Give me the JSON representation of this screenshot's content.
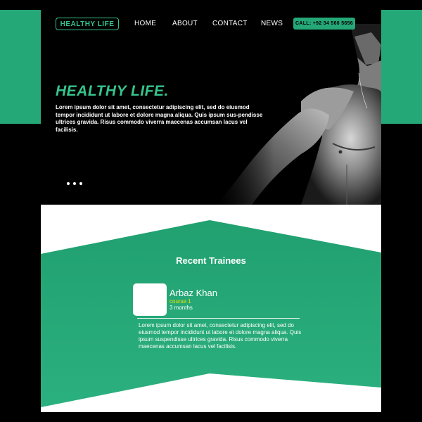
{
  "brand": {
    "logo_text": "HEALTHY LIFE",
    "accent_color": "#36c48d",
    "band_color": "#25a878"
  },
  "nav": {
    "items": [
      {
        "label": "HOME"
      },
      {
        "label": "ABOUT"
      },
      {
        "label": "CONTACT"
      },
      {
        "label": "NEWS"
      }
    ],
    "call_label": "CALL: +92 34 566 5656"
  },
  "hero": {
    "title": "HEALTHY LIFE.",
    "text": "Lorem ipsum dolor sit amet, consectetur adipiscing elit, sed do eiusmod tempor incididunt ut labore et dolore magna aliqua. Quis ipsum sus-pendisse ultrices gravida. Risus commodo viverra maecenas accumsan lacus vel facilisis.",
    "carousel_dots": 3
  },
  "trainees": {
    "title": "Recent Trainees",
    "items": [
      {
        "name": "Arbaz Khan",
        "course": "course 1",
        "duration": "3 months",
        "text": "Lorem ipsum dolor sit amet, consectetur adipiscing elit, sed do eiusmod tempor incididunt ut labore et dolore magna aliqua. Quis ipsum suspendisse ultrices gravida. Risus commodo viverra maecenas accumsan lacus vel facilisis."
      }
    ]
  }
}
